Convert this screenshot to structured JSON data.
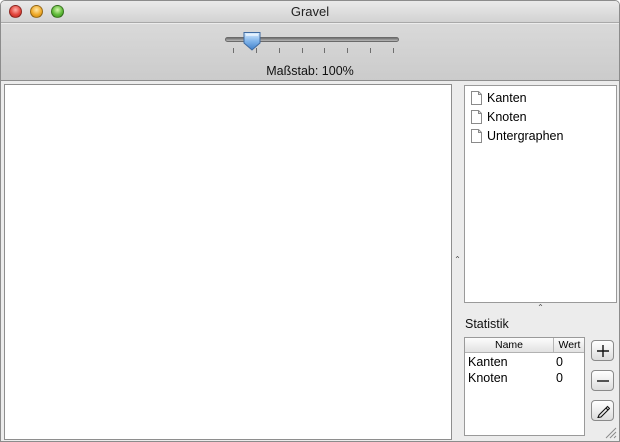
{
  "window": {
    "title": "Gravel",
    "buttons": [
      "close-icon",
      "minimize-icon",
      "zoom-icon"
    ]
  },
  "toolbar": {
    "scale_label": "Maßstab: 100%",
    "slider_position": 0.12,
    "tick_count": 8
  },
  "outline": {
    "items": [
      {
        "label": "Kanten",
        "icon": "document-icon"
      },
      {
        "label": "Knoten",
        "icon": "document-icon"
      },
      {
        "label": "Untergraphen",
        "icon": "document-icon"
      }
    ]
  },
  "stats": {
    "title": "Statistik",
    "columns": [
      "Name",
      "Wert"
    ],
    "rows": [
      {
        "name": "Kanten",
        "value": "0"
      },
      {
        "name": "Knoten",
        "value": "0"
      }
    ]
  },
  "side_buttons": [
    "plus-icon",
    "minus-icon",
    "pencil-icon"
  ],
  "colors": {
    "close": "#e2463d",
    "minimize": "#efaa2a",
    "zoom": "#5fba39",
    "slider_knob": "#7fb3ea"
  }
}
